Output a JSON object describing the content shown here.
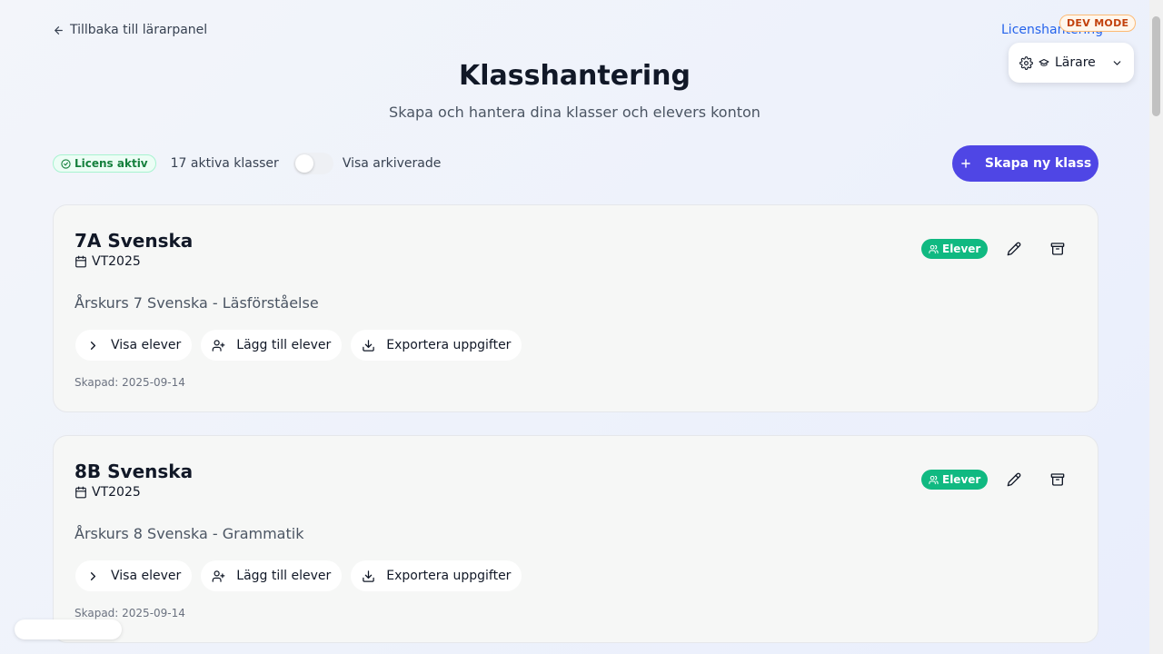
{
  "nav": {
    "back_label": "Tillbaka till lärarpanel",
    "license_link": "Licenshantering"
  },
  "dev_badge": "DEV MODE",
  "role_switcher": {
    "label": "Lärare"
  },
  "header": {
    "title": "Klasshantering",
    "subtitle": "Skapa och hantera dina klasser och elevers konton"
  },
  "toolbar": {
    "license_status": "Licens aktiv",
    "active_count": "17 aktiva klasser",
    "show_archived_label": "Visa arkiverade",
    "show_archived_on": false,
    "create_button": "Skapa ny klass"
  },
  "classes": [
    {
      "name": "7A Svenska",
      "term": "VT2025",
      "description": "Årskurs 7 Svenska - Läsförståelse",
      "badge": "Elever",
      "actions": {
        "view": "Visa elever",
        "add": "Lägg till elever",
        "export": "Exportera uppgifter"
      },
      "created": "Skapad: 2025-09-14"
    },
    {
      "name": "8B Svenska",
      "term": "VT2025",
      "description": "Årskurs 8 Svenska - Grammatik",
      "badge": "Elever",
      "actions": {
        "view": "Visa elever",
        "add": "Lägg till elever",
        "export": "Exportera uppgifter"
      },
      "created": "Skapad: 2025-09-14"
    }
  ],
  "colors": {
    "primary": "#4f46e5",
    "success": "#10b981",
    "link": "#2563eb",
    "dev": "#c2410c"
  }
}
